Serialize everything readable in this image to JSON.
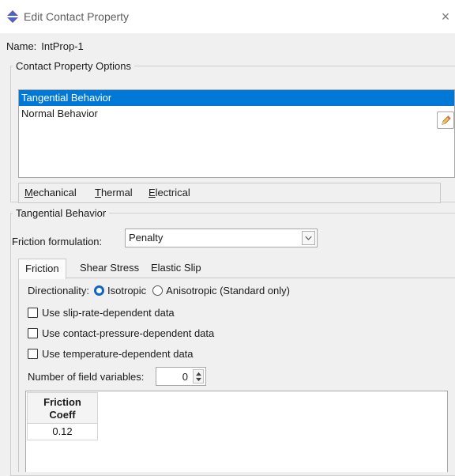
{
  "window": {
    "title": "Edit Contact Property",
    "app_icon": "abaqus-diamond-icon",
    "close_glyph": "×"
  },
  "name": {
    "label": "Name:",
    "value": "IntProp-1"
  },
  "contact_property_options": {
    "legend": "Contact Property Options",
    "items": [
      {
        "label": "Tangential Behavior",
        "selected": true
      },
      {
        "label": "Normal Behavior",
        "selected": false
      }
    ],
    "menus": [
      {
        "accel": "M",
        "rest": "echanical"
      },
      {
        "accel": "T",
        "rest": "hermal"
      },
      {
        "accel": "E",
        "rest": "lectrical"
      }
    ],
    "edit_icon": "pencil-icon"
  },
  "tangential_behavior": {
    "legend": "Tangential Behavior",
    "friction_formulation": {
      "label": "Friction formulation:",
      "value": "Penalty"
    },
    "tabs": [
      {
        "label": "Friction",
        "active": true
      },
      {
        "label": "Shear Stress",
        "active": false
      },
      {
        "label": "Elastic Slip",
        "active": false
      }
    ],
    "directionality": {
      "label": "Directionality:",
      "options": [
        {
          "label": "Isotropic",
          "selected": true
        },
        {
          "label": "Anisotropic (Standard only)",
          "selected": false
        }
      ]
    },
    "checkboxes": [
      {
        "label": "Use slip-rate-dependent data",
        "checked": false
      },
      {
        "label": "Use contact-pressure-dependent data",
        "checked": false
      },
      {
        "label": "Use temperature-dependent data",
        "checked": false
      }
    ],
    "field_variables": {
      "label": "Number of field variables:",
      "value": "0"
    },
    "table": {
      "header_line1": "Friction",
      "header_line2": "Coeff",
      "rows": [
        "0.12"
      ]
    }
  },
  "colors": {
    "selection": "#0078d7",
    "radio_accent": "#0f63c9",
    "window_bg": "#f0f0f0"
  }
}
